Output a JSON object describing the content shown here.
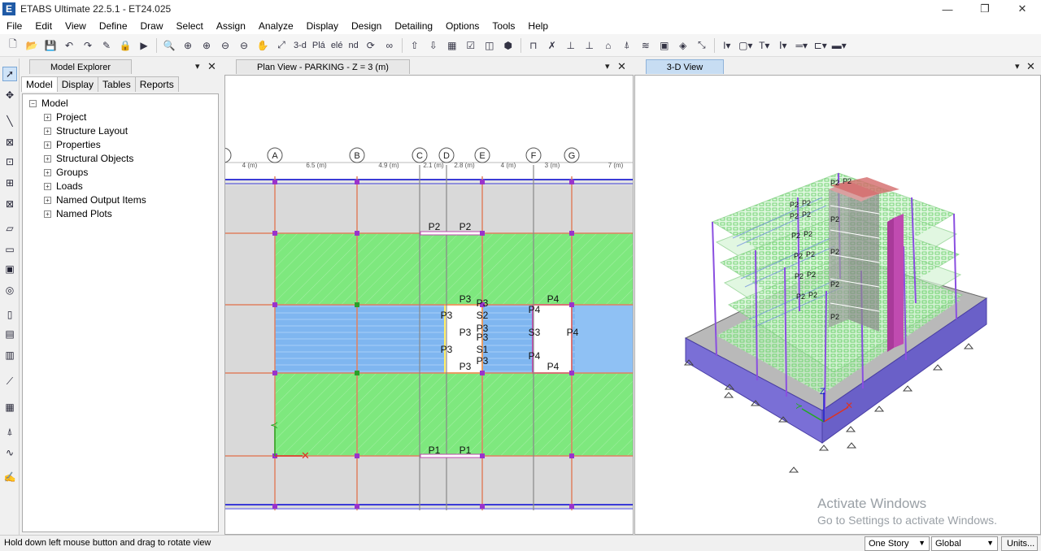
{
  "app": {
    "title": "ETABS Ultimate 22.5.1 - ET24.025",
    "logo_letter": "E"
  },
  "window_controls": {
    "minimize": "—",
    "restore": "❐",
    "close": "✕"
  },
  "menu": [
    "File",
    "Edit",
    "View",
    "Define",
    "Draw",
    "Select",
    "Assign",
    "Analyze",
    "Display",
    "Design",
    "Detailing",
    "Options",
    "Tools",
    "Help"
  ],
  "toolbar": {
    "label_3d": "3-d",
    "label_pla": "Plá",
    "label_elev": "elé",
    "label_nd": "nd"
  },
  "model_explorer": {
    "title": "Model Explorer",
    "tabs": [
      "Model",
      "Display",
      "Tables",
      "Reports"
    ],
    "root": "Model",
    "items": [
      "Project",
      "Structure Layout",
      "Properties",
      "Structural Objects",
      "Groups",
      "Loads",
      "Named Output Items",
      "Named Plots"
    ]
  },
  "plan_view": {
    "title": "Plan View - PARKING - Z = 3 (m)",
    "grids": [
      "A",
      "B",
      "C",
      "D",
      "E",
      "F",
      "G"
    ],
    "spacings": [
      "4 (m)",
      "6.5 (m)",
      "4.9 (m)",
      "2.1 (m)",
      "2.8 (m)",
      "4 (m)",
      "3 (m)",
      "7 (m)"
    ],
    "labels": {
      "p1": "P1",
      "p2": "P2",
      "p3": "P3",
      "p4": "P4",
      "s1": "S1",
      "s2": "S2",
      "s3": "S3"
    }
  },
  "view_3d": {
    "title": "3-D View",
    "pier_label": "P2"
  },
  "status": {
    "message": "Hold down left mouse button and drag to rotate view",
    "story": "One Story",
    "coord": "Global",
    "units": "Units..."
  },
  "watermark": {
    "line1": "Activate Windows",
    "line2": "Go to Settings to activate Windows."
  },
  "colors": {
    "slab_green": "#7ee87e",
    "deck_blue": "#7fb6f0",
    "wall_purple": "#7a6fd6",
    "pier_pink": "#c04bb0"
  }
}
